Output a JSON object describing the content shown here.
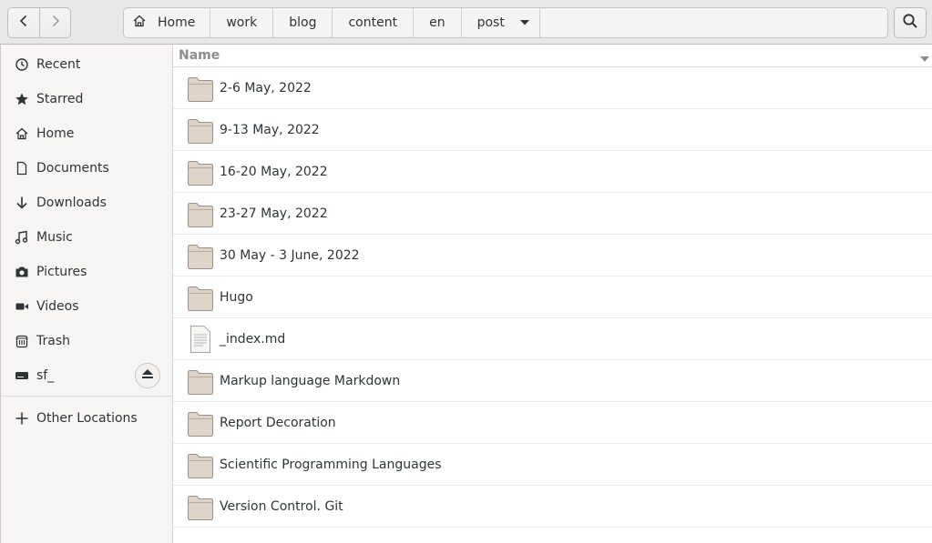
{
  "header": {
    "back_icon": "go-previous-icon",
    "forward_icon": "go-next-icon",
    "search_icon": "search-icon",
    "path": [
      {
        "label": "Home",
        "icon": "home-icon"
      },
      {
        "label": "work"
      },
      {
        "label": "blog"
      },
      {
        "label": "content"
      },
      {
        "label": "en"
      },
      {
        "label": "post",
        "icon": "chevron-down-icon"
      }
    ]
  },
  "sidebar": {
    "items": [
      {
        "label": "Recent",
        "icon": "clock-icon"
      },
      {
        "label": "Starred",
        "icon": "star-icon"
      },
      {
        "label": "Home",
        "icon": "home-icon"
      },
      {
        "label": "Documents",
        "icon": "document-icon"
      },
      {
        "label": "Downloads",
        "icon": "download-icon"
      },
      {
        "label": "Music",
        "icon": "music-icon"
      },
      {
        "label": "Pictures",
        "icon": "camera-icon"
      },
      {
        "label": "Videos",
        "icon": "video-icon"
      },
      {
        "label": "Trash",
        "icon": "trash-icon"
      },
      {
        "label": "sf_",
        "icon": "drive-icon",
        "eject_icon": "eject-icon"
      }
    ],
    "other_locations": {
      "label": "Other Locations",
      "icon": "plus-icon"
    }
  },
  "main": {
    "column_header": "Name",
    "sort_icon": "sort-descending-icon",
    "files": [
      {
        "name": "2-6 May, 2022",
        "type": "folder"
      },
      {
        "name": "9-13 May, 2022",
        "type": "folder"
      },
      {
        "name": "16-20 May, 2022",
        "type": "folder"
      },
      {
        "name": "23-27 May, 2022",
        "type": "folder"
      },
      {
        "name": "30 May - 3 June, 2022",
        "type": "folder"
      },
      {
        "name": "Hugo",
        "type": "folder"
      },
      {
        "name": "_index.md",
        "type": "text-file"
      },
      {
        "name": "Markup language Markdown",
        "type": "folder"
      },
      {
        "name": "Report Decoration",
        "type": "folder"
      },
      {
        "name": "Scientific Programming Languages",
        "type": "folder"
      },
      {
        "name": "Version Control. Git",
        "type": "folder"
      }
    ]
  },
  "colors": {
    "header_bg": "#e8e8e7",
    "sidebar_bg": "#f6f5f4",
    "folder_fill": "#ddd3c6",
    "folder_stroke": "#9d9086",
    "text": "#2e3436",
    "column_header_text": "#8a8d8a"
  }
}
